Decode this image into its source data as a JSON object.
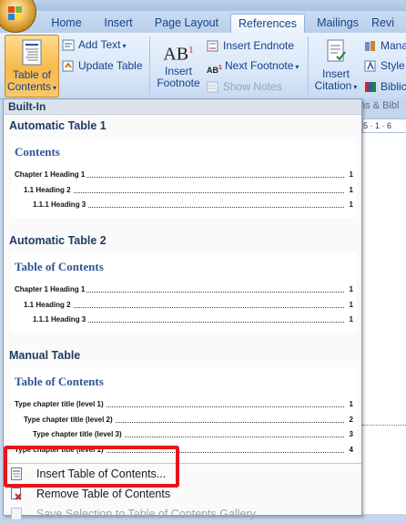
{
  "ribbon_tabs": [
    "Home",
    "Insert",
    "Page Layout",
    "References",
    "Mailings",
    "Revi"
  ],
  "active_tab": "References",
  "ribbon": {
    "toc_button": {
      "line1": "Table of",
      "line2": "Contents"
    },
    "add_text": "Add Text",
    "update_table": "Update Table",
    "footnote_icon_text": "AB",
    "footnote_icon_sup": "1",
    "insert_footnote": {
      "line1": "Insert",
      "line2": "Footnote"
    },
    "insert_endnote": "Insert Endnote",
    "next_footnote": "Next Footnote",
    "next_footnote_icon_text": "AB",
    "next_footnote_icon_sup": "1",
    "show_notes": "Show Notes",
    "insert_citation": {
      "line1": "Insert",
      "line2": "Citation"
    },
    "manage_sources": "Mana",
    "style": "Style",
    "bibliography": "Biblic",
    "group_label_partial": "ns & Bibl",
    "ruler_text": "5 · 1 · 6"
  },
  "gallery": {
    "header": "Built-In",
    "sections": [
      {
        "title": "Automatic Table 1",
        "preview_heading": "Contents",
        "lines": [
          {
            "text": "Chapter 1     Heading 1",
            "page": "1",
            "level": 1
          },
          {
            "text": "1.1       Heading 2",
            "page": "1",
            "level": 2
          },
          {
            "text": "1.1.1       Heading 3",
            "page": "1",
            "level": 3
          }
        ]
      },
      {
        "title": "Automatic Table 2",
        "preview_heading": "Table of Contents",
        "lines": [
          {
            "text": "Chapter 1     Heading 1",
            "page": "1",
            "level": 1
          },
          {
            "text": "1.1       Heading 2",
            "page": "1",
            "level": 2
          },
          {
            "text": "1.1.1       Heading 3",
            "page": "1",
            "level": 3
          }
        ]
      },
      {
        "title": "Manual Table",
        "preview_heading": "Table of Contents",
        "lines": [
          {
            "text": "Type chapter title (level 1)",
            "page": "1",
            "level": 1
          },
          {
            "text": "Type chapter title (level 2)",
            "page": "2",
            "level": 2
          },
          {
            "text": "Type chapter title (level 3)",
            "page": "3",
            "level": 3
          },
          {
            "text": "Type chapter title (level 1)",
            "page": "4",
            "level": 1
          }
        ]
      }
    ],
    "menu_items": [
      {
        "label": "Insert Table of Contents...",
        "icon": "toc-icon",
        "disabled": false
      },
      {
        "label": "Remove Table of Contents",
        "icon": "remove-toc-icon",
        "disabled": false
      },
      {
        "label": "Save Selection to Table of Contents Gallery",
        "icon": "save-gallery-icon",
        "disabled": true
      }
    ]
  },
  "colors": {
    "highlight": "#e8141a",
    "ribbon_text": "#15428b",
    "toc_heading": "#2f5496"
  }
}
